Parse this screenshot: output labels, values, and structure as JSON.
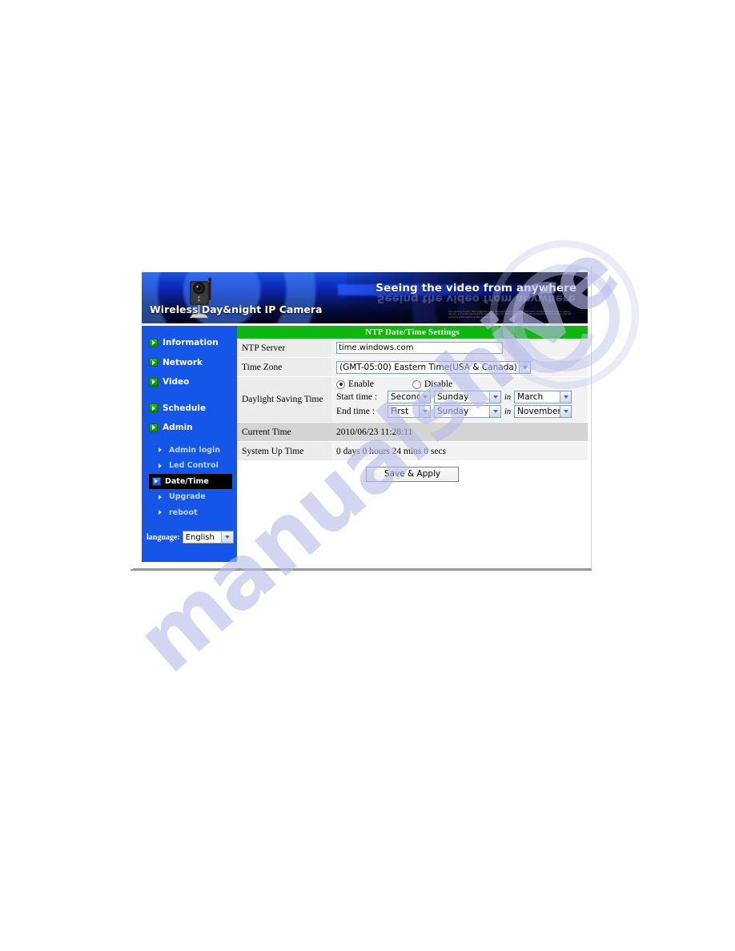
{
  "banner": {
    "headline": "Seeing the video from anywhere",
    "product": "Wireless Day&night IP Camera",
    "blurb": "The sunshine to learn their suggestions, the massage to push the times, this is the combination that leads to helping devices, and on the world of automation engineering. Design and comfort, safety and performance. Serve are the key elements of the system of the make it opens.",
    "camera_icon": "ip-camera-icon"
  },
  "sidebar": {
    "items": [
      {
        "label": "Information",
        "icon": "green-arrow-icon"
      },
      {
        "label": "Network",
        "icon": "green-arrow-icon"
      },
      {
        "label": "Video",
        "icon": "green-arrow-icon"
      },
      {
        "label": "Schedule",
        "icon": "green-arrow-icon"
      },
      {
        "label": "Admin",
        "icon": "green-arrow-icon"
      }
    ],
    "sub_items": [
      {
        "label": "Admin login",
        "active": false
      },
      {
        "label": "Led Control",
        "active": false
      },
      {
        "label": "Date/Time",
        "active": true
      },
      {
        "label": "Upgrade",
        "active": false
      },
      {
        "label": "reboot",
        "active": false
      }
    ],
    "language": {
      "label": "language:",
      "value": "English"
    },
    "bg_color": "#1556e8"
  },
  "main": {
    "section_title": "NTP Date/Time Settings",
    "section_title_bg": "#11b511",
    "rows": {
      "ntp_server": {
        "label": "NTP Server",
        "value": "time.windows.com"
      },
      "time_zone": {
        "label": "Time Zone",
        "value": "(GMT-05:00) Eastern Time(USA & Canada)"
      },
      "daylight_saving": {
        "label": "Daylight Saving Time",
        "enable_label": "Enable",
        "disable_label": "Disable",
        "selected": "Enable",
        "start_caption": "Start time :",
        "start_week": "Second",
        "start_day": "Sunday",
        "start_in": "in",
        "start_month": "March",
        "end_caption": "End time  :",
        "end_week": "First",
        "end_day": "Sunday",
        "end_in": "in",
        "end_month": "November"
      },
      "current_time": {
        "label": "Current Time",
        "value": "2010/06/23 11:28:11"
      },
      "system_up_time": {
        "label": "System Up Time",
        "value": "0 days 0 hours 24 mins 0 secs"
      }
    },
    "save_button": "Save & Apply"
  },
  "watermark": {
    "text": "manualshive"
  }
}
